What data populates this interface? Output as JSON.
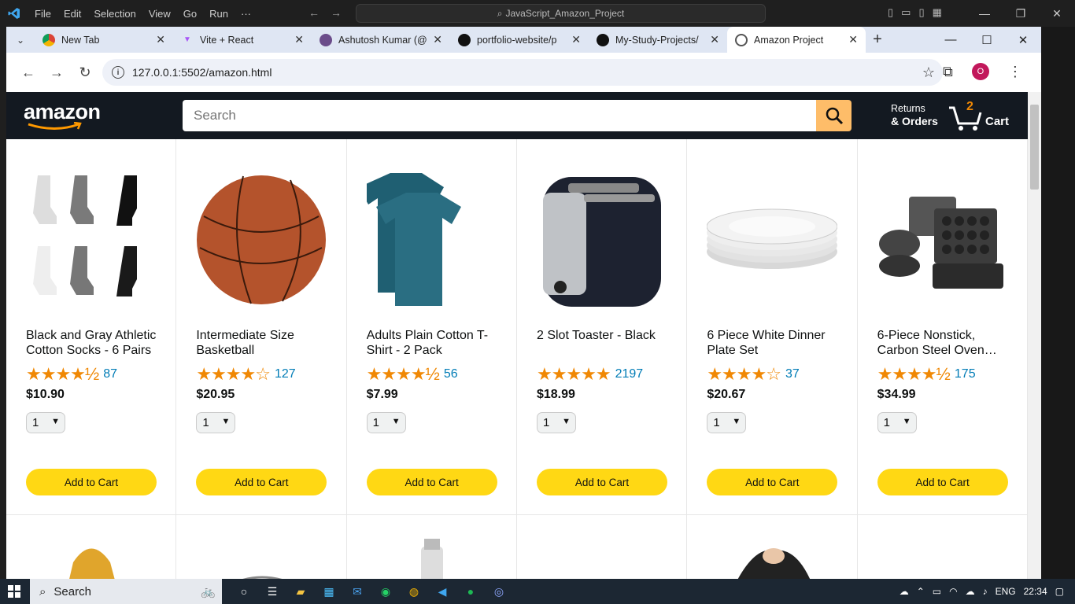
{
  "vscode": {
    "menu": [
      "File",
      "Edit",
      "Selection",
      "View",
      "Go",
      "Run",
      "···"
    ],
    "search_text": "JavaScript_Amazon_Project"
  },
  "browser": {
    "tabs": [
      {
        "title": "New Tab",
        "icon": "chrome-icon"
      },
      {
        "title": "Vite + React",
        "icon": "vite-icon"
      },
      {
        "title": "Ashutosh Kumar (@",
        "icon": "avatar-icon"
      },
      {
        "title": "portfolio-website/p",
        "icon": "github-icon"
      },
      {
        "title": "My-Study-Projects/",
        "icon": "github-icon"
      },
      {
        "title": "Amazon Project",
        "icon": "globe-icon"
      }
    ],
    "url": "127.0.0.1:5502/amazon.html",
    "profile_initial": "O"
  },
  "amazon": {
    "logo_text": "amazon",
    "search_placeholder": "Search",
    "returns_line1": "Returns",
    "returns_line2": "& Orders",
    "cart_quantity": "2",
    "cart_label": "Cart",
    "accent_color": "#febd69",
    "button_color": "#ffd814",
    "products": [
      {
        "name": "Black and Gray Athletic Cotton Socks - 6 Pairs",
        "stars": "★★★★½",
        "rating_value": 4.5,
        "rating_count": "87",
        "price": "$10.90",
        "quantity": "1",
        "button": "Add to Cart"
      },
      {
        "name": "Intermediate Size Basketball",
        "stars": "★★★★☆",
        "rating_value": 4.0,
        "rating_count": "127",
        "price": "$20.95",
        "quantity": "1",
        "button": "Add to Cart"
      },
      {
        "name": "Adults Plain Cotton T-Shirt - 2 Pack",
        "stars": "★★★★½",
        "rating_value": 4.5,
        "rating_count": "56",
        "price": "$7.99",
        "quantity": "1",
        "button": "Add to Cart"
      },
      {
        "name": "2 Slot Toaster - Black",
        "stars": "★★★★★",
        "rating_value": 5.0,
        "rating_count": "2197",
        "price": "$18.99",
        "quantity": "1",
        "button": "Add to Cart"
      },
      {
        "name": "6 Piece White Dinner Plate Set",
        "stars": "★★★★☆",
        "rating_value": 4.0,
        "rating_count": "37",
        "price": "$20.67",
        "quantity": "1",
        "button": "Add to Cart"
      },
      {
        "name": "6-Piece Nonstick, Carbon Steel Oven…",
        "stars": "★★★★½",
        "rating_value": 4.5,
        "rating_count": "175",
        "price": "$34.99",
        "quantity": "1",
        "button": "Add to Cart"
      }
    ]
  },
  "taskbar": {
    "search_label": "Search",
    "language": "ENG",
    "time": "22:34"
  }
}
